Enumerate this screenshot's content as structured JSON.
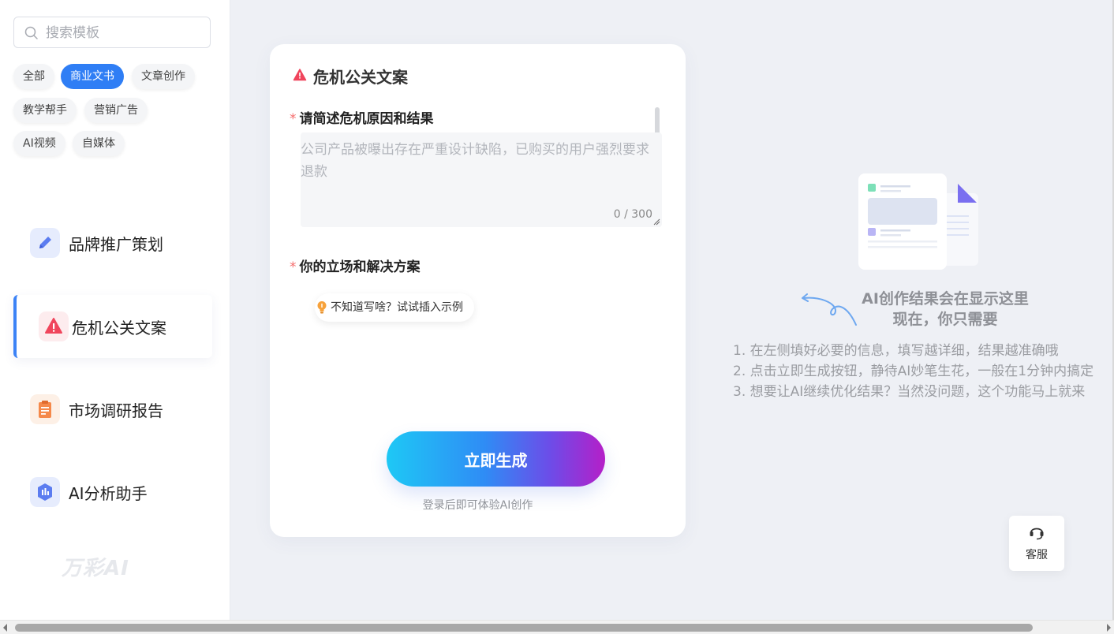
{
  "search": {
    "placeholder": "搜索模板",
    "icon": "search-icon"
  },
  "categories": [
    {
      "label": "全部"
    },
    {
      "label": "商业文书"
    },
    {
      "label": "文章创作"
    },
    {
      "label": "教学帮手"
    },
    {
      "label": "营销广告"
    },
    {
      "label": "AI视频"
    },
    {
      "label": "自媒体"
    }
  ],
  "active_category": "商业文书",
  "templates": [
    {
      "label": "品牌推广策划",
      "icon": "pen-icon"
    },
    {
      "label": "危机公关文案",
      "icon": "warning-icon"
    },
    {
      "label": "市场调研报告",
      "icon": "clipboard-icon"
    },
    {
      "label": "AI分析助手",
      "icon": "chart-hexagon-icon"
    }
  ],
  "active_template": "危机公关文案",
  "brand": {
    "logo_text": "万彩AI"
  },
  "form": {
    "title": "危机公关文案",
    "field1": {
      "required_mark": "*",
      "label": "请简述危机原因和结果",
      "placeholder": "公司产品被曝出存在严重设计缺陷，已购买的用户强烈要求退款",
      "value": "",
      "counter": "0 / 300"
    },
    "field2": {
      "required_mark": "*",
      "label": "你的立场和解决方案"
    },
    "hint": "不知道写啥？试试插入示例",
    "generate_label": "立即生成",
    "login_tip": "登录后即可体验AI创作"
  },
  "result": {
    "title_line1": "AI创作结果会在显示这里",
    "title_line2": "现在，你只需要",
    "steps": [
      "1. 在左侧填好必要的信息，填写越详细，结果越准确哦",
      "2. 点击立即生成按钮，静待AI妙笔生花，一般在1分钟内搞定",
      "3. 想要让AI继续优化结果？当然没问题，这个功能马上就来"
    ]
  },
  "service": {
    "label": "客服",
    "icon": "headset-icon"
  },
  "colors": {
    "accent": "#2f7ef5",
    "active_border": "#3b82f6",
    "required": "#f56c6c",
    "gradient_start": "#1ec8f5",
    "gradient_end": "#b51fc8"
  }
}
